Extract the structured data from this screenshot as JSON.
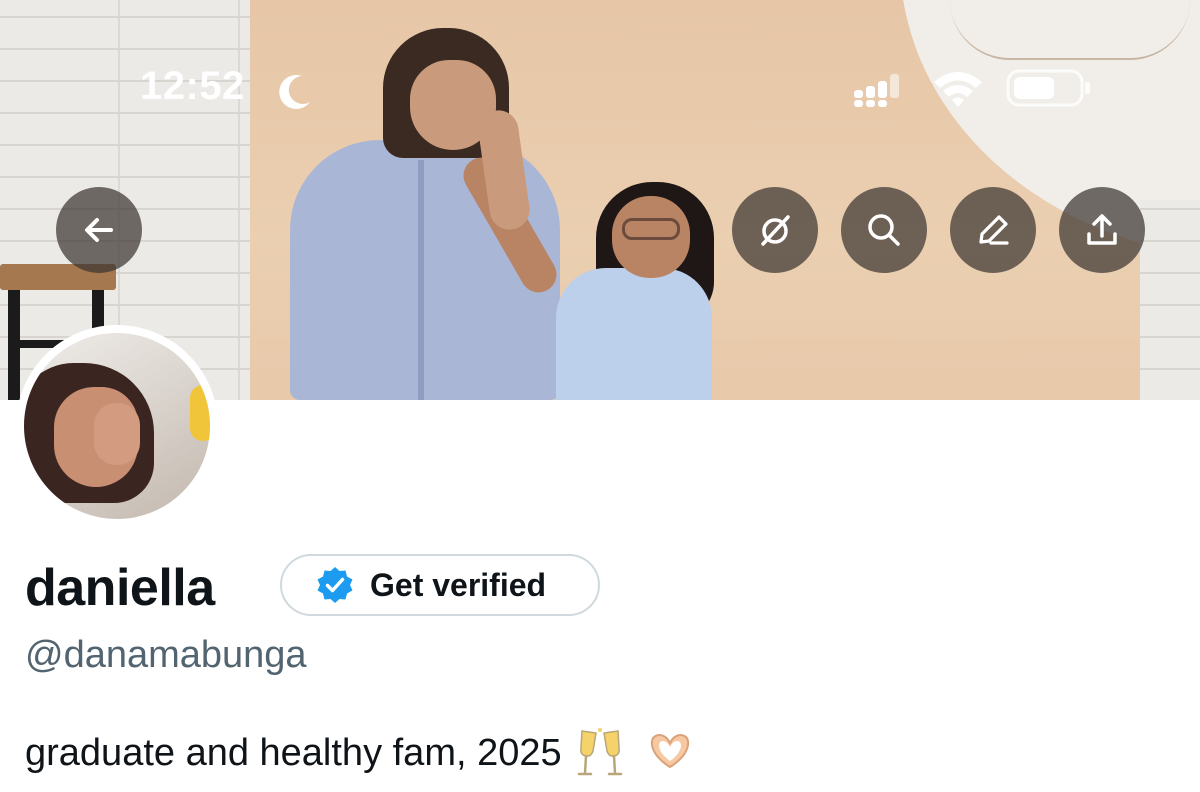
{
  "status_bar": {
    "time": "12:52",
    "icons": [
      "moon-icon",
      "signal-icon",
      "wifi-icon",
      "battery-icon"
    ]
  },
  "header": {
    "buttons": [
      {
        "name": "back",
        "icon": "arrow-left-icon"
      },
      {
        "name": "grok",
        "icon": "grok-icon"
      },
      {
        "name": "search",
        "icon": "search-icon"
      },
      {
        "name": "edit",
        "icon": "pencil-icon"
      },
      {
        "name": "share",
        "icon": "share-icon"
      }
    ]
  },
  "profile": {
    "display_name": "daniella",
    "verify_label": "Get verified",
    "handle": "@danamabunga",
    "bio": "graduate and healthy fam, 2025",
    "bio_emojis": [
      "clinking-glasses-icon",
      "heart-hands-icon"
    ]
  },
  "colors": {
    "text_primary": "#0f1419",
    "text_secondary": "#536471",
    "verified_blue": "#1d9bf0",
    "button_border": "#cfd9de",
    "overlay_button": "#3c3632"
  }
}
